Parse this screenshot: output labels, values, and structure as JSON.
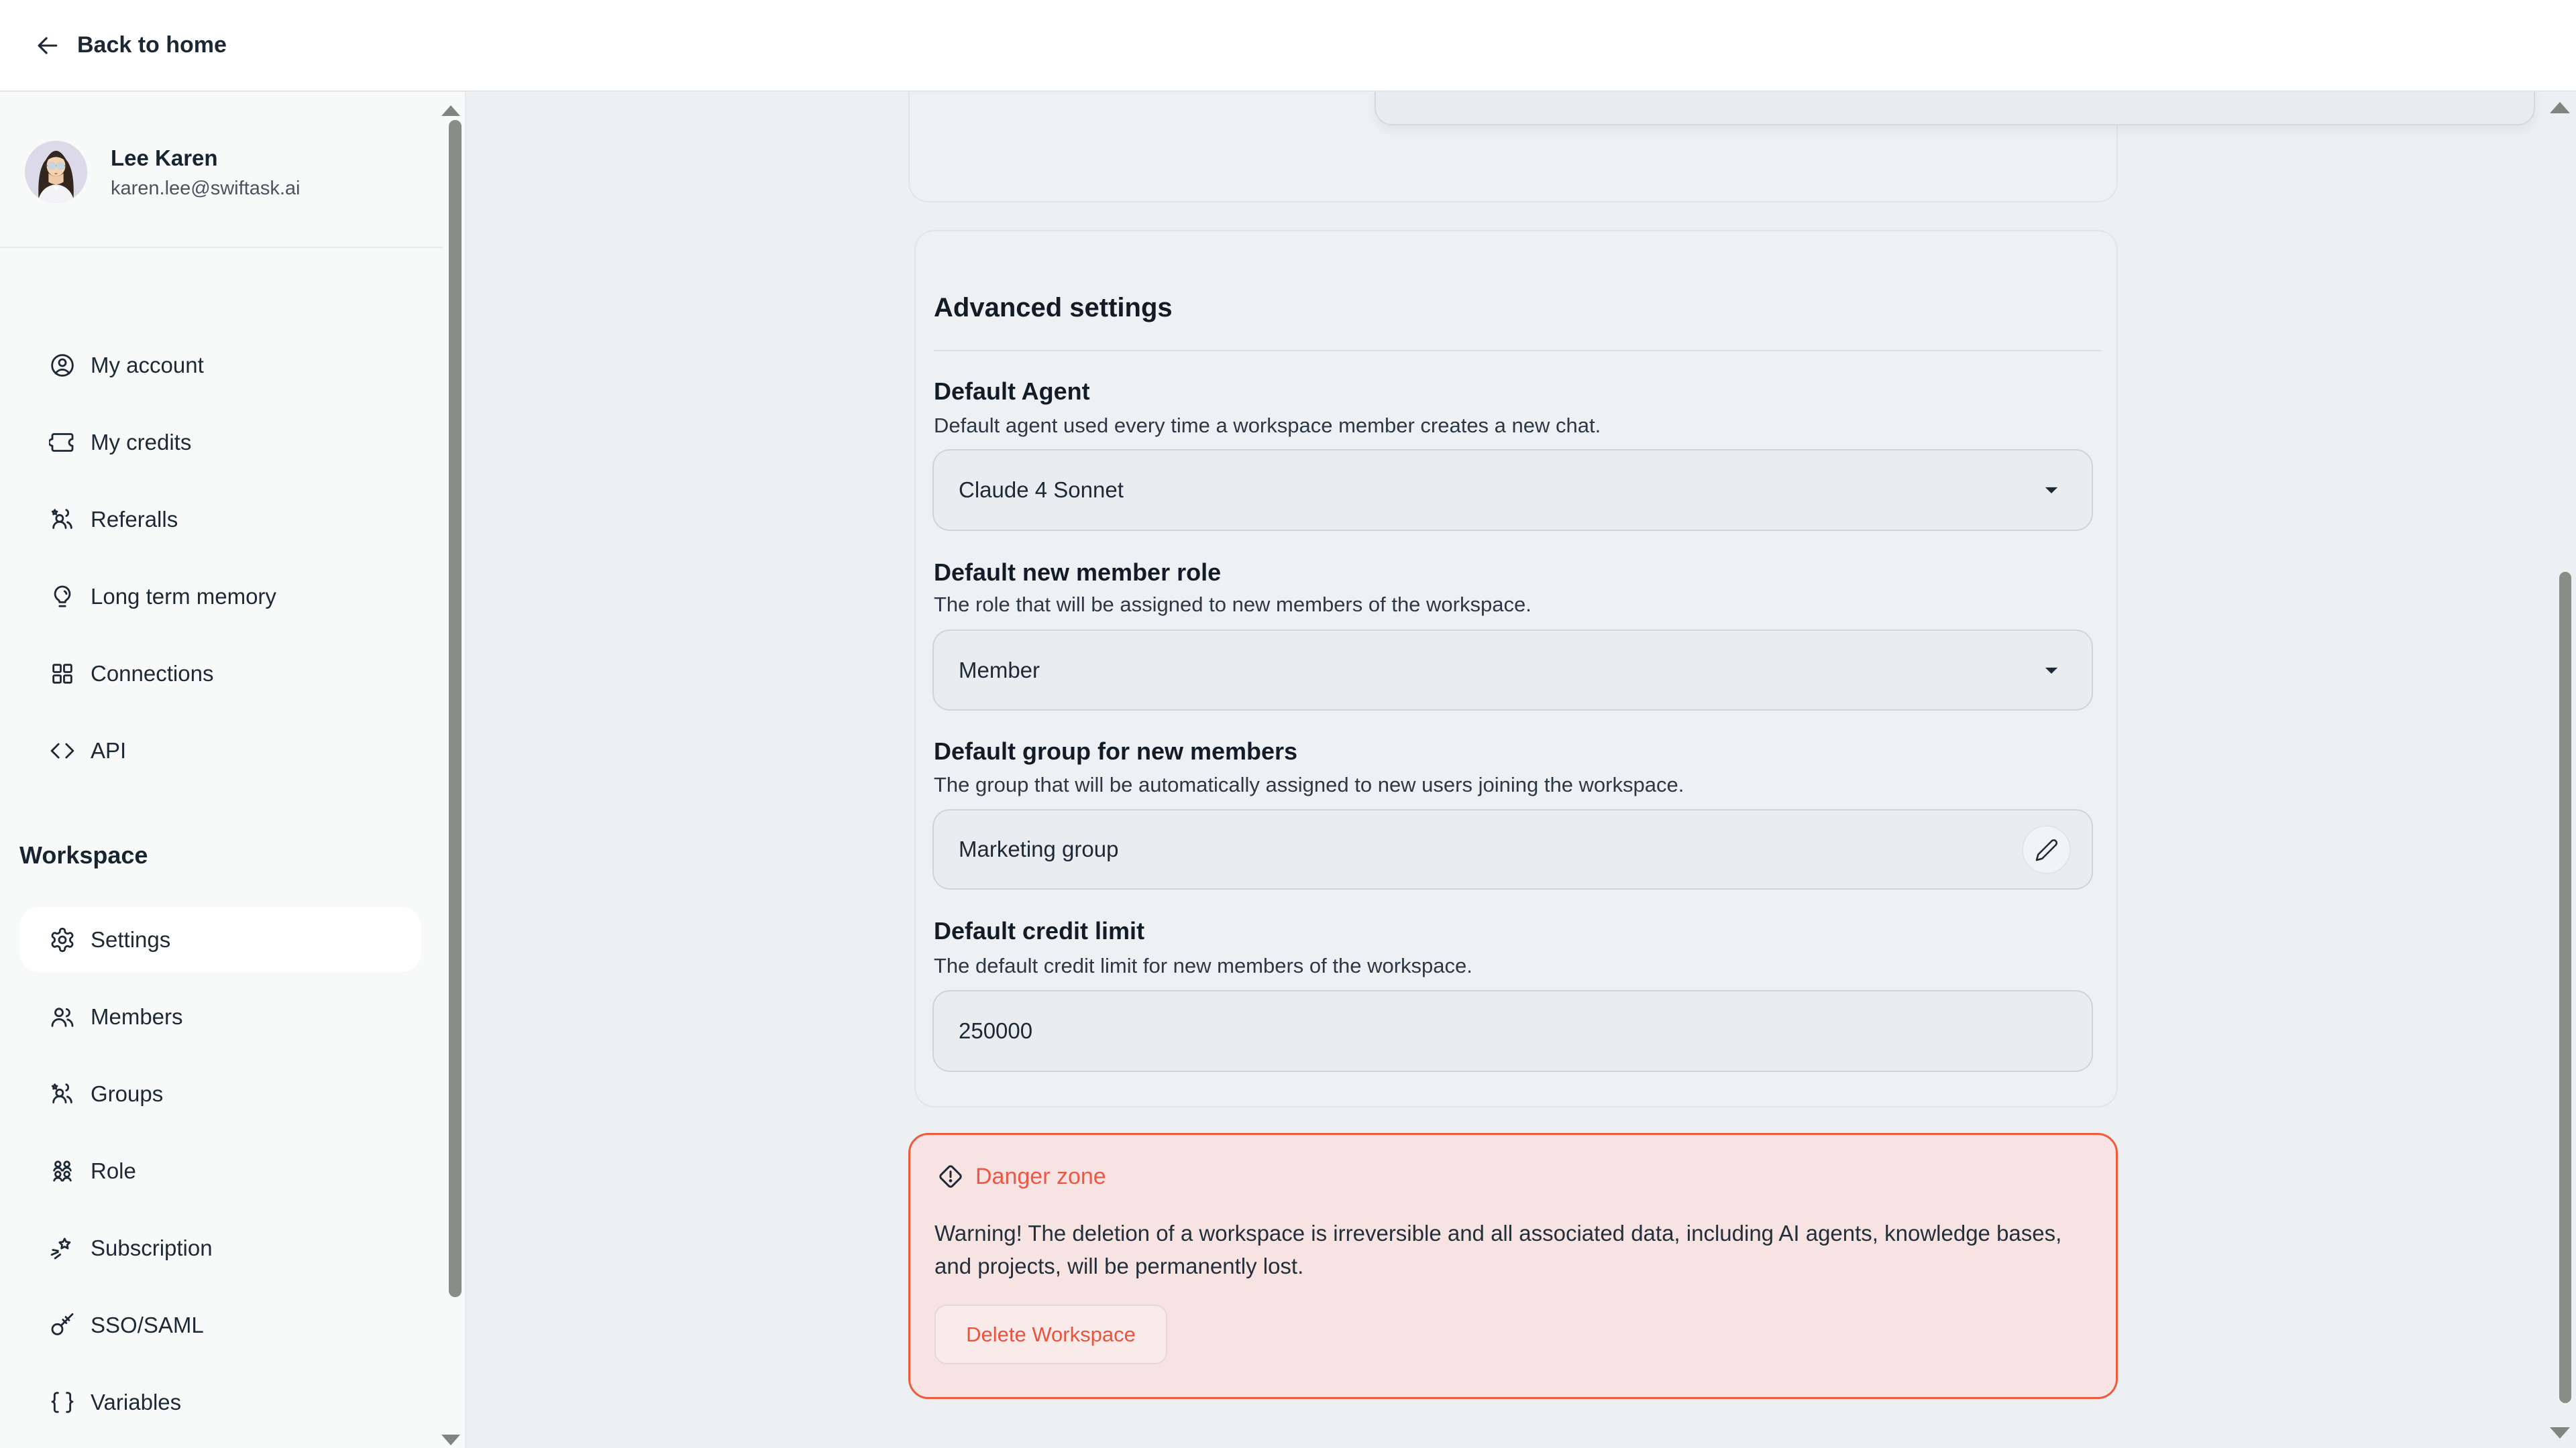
{
  "topbar": {
    "back_label": "Back to home",
    "back_icon": "arrow-left-icon"
  },
  "sidebar": {
    "user": {
      "name": "Lee Karen",
      "email": "karen.lee@swiftask.ai",
      "avatar": "woman-glasses-illustration"
    },
    "account_items": [
      {
        "label": "My account",
        "icon": "user-circle-icon"
      },
      {
        "label": "My credits",
        "icon": "ticket-icon"
      },
      {
        "label": "Referalls",
        "icon": "users-star-icon"
      },
      {
        "label": "Long term memory",
        "icon": "lightbulb-icon"
      },
      {
        "label": "Connections",
        "icon": "grid-icon"
      },
      {
        "label": "API",
        "icon": "code-icon"
      }
    ],
    "workspace_label": "Workspace",
    "workspace_items": [
      {
        "label": "Settings",
        "icon": "gear-icon",
        "active": true
      },
      {
        "label": "Members",
        "icon": "members-icon",
        "active": false
      },
      {
        "label": "Groups",
        "icon": "groups-icon",
        "active": false
      },
      {
        "label": "Role",
        "icon": "role-users-icon",
        "active": false
      },
      {
        "label": "Subscription",
        "icon": "shooting-star-icon",
        "active": false
      },
      {
        "label": "SSO/SAML",
        "icon": "key-icon",
        "active": false
      },
      {
        "label": "Variables",
        "icon": "braces-icon",
        "active": false
      }
    ]
  },
  "main": {
    "chat_input": {
      "value": "",
      "mic_icon": "microphone-icon"
    },
    "advanced": {
      "title": "Advanced settings",
      "default_agent": {
        "label": "Default Agent",
        "description": "Default agent used every time a workspace member creates a new chat.",
        "value": "Claude 4 Sonnet",
        "control": "dropdown"
      },
      "member_role": {
        "label": "Default new member role",
        "description": "The role that will be assigned to new members of the workspace.",
        "value": "Member",
        "control": "dropdown"
      },
      "default_group": {
        "label": "Default group for new members",
        "description": "The group that will be automatically assigned to new users joining the workspace.",
        "value": "Marketing group",
        "edit_icon": "pencil-icon"
      },
      "credit_limit": {
        "label": "Default credit limit",
        "description": "The default credit limit for new members of the workspace.",
        "value": "250000"
      }
    },
    "danger": {
      "icon": "alert-diamond-icon",
      "title": "Danger zone",
      "warning": "Warning! The deletion of a workspace is irreversible and all associated data, including AI agents, knowledge bases, and projects, will be permanently lost.",
      "delete_label": "Delete Workspace"
    }
  },
  "colors": {
    "page_bg": "#edf0f2",
    "sidebar_bg": "#f8fafa",
    "topbar_bg": "#ffffff",
    "field_bg": "#e9edf0",
    "active_pill": "#ffffff",
    "text_primary": "#1d2935",
    "danger_border": "#ee5a3d",
    "danger_bg": "#f7e4e2",
    "danger_text": "#ef5744",
    "scrollbar_thumb": "#878d87"
  }
}
